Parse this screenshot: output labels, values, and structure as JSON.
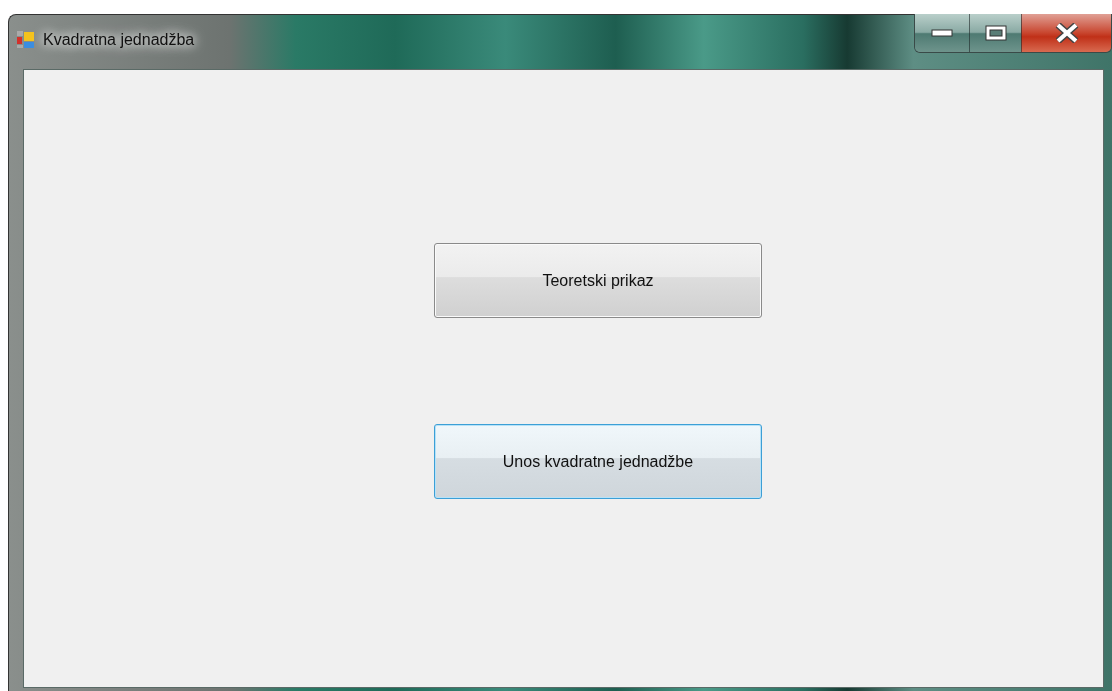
{
  "window": {
    "title": "Kvadratna jednadžba"
  },
  "buttons": [
    {
      "label": "Teoretski prikaz",
      "focused": false
    },
    {
      "label": "Unos kvadratne jednadžbe",
      "focused": true
    }
  ]
}
